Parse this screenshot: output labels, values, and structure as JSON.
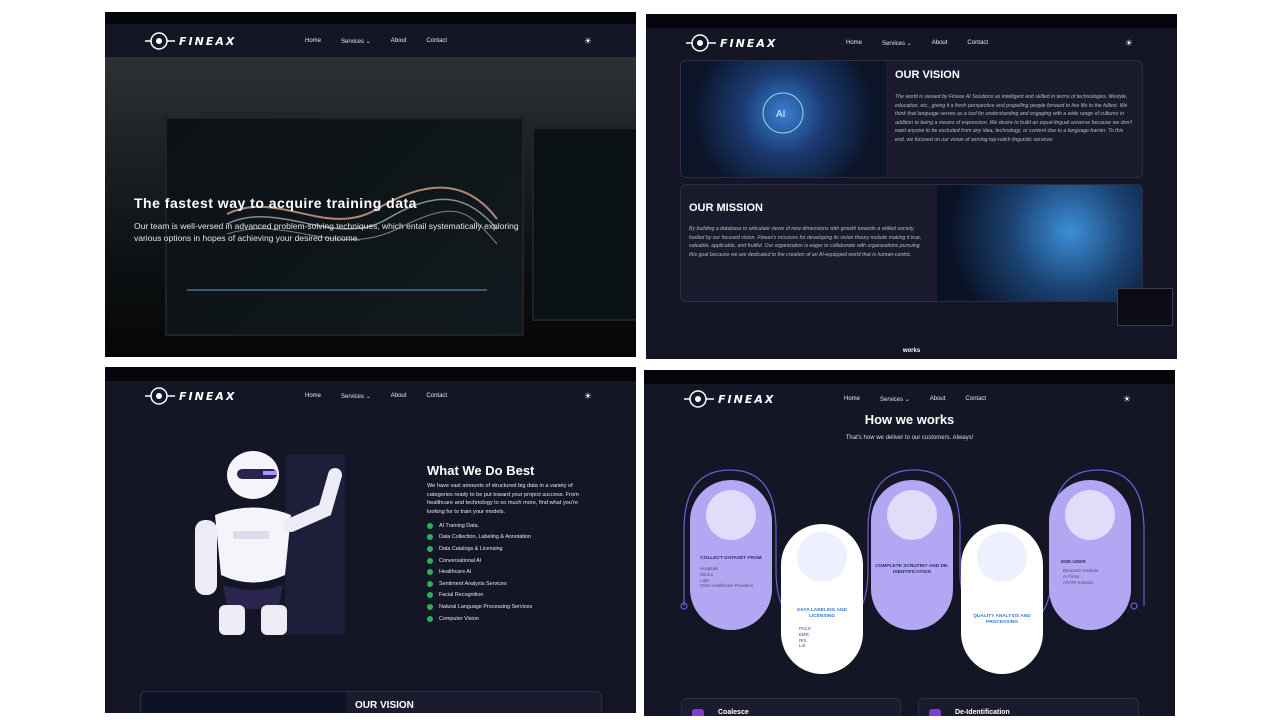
{
  "brand": {
    "name": "FINEAX"
  },
  "nav": {
    "home": "Home",
    "services": "Services",
    "about": "About",
    "contact": "Contact"
  },
  "hero": {
    "title": "The fastest way to acquire training data",
    "subtitle": "Our team is well-versed in advanced problem-solving techniques, which entail systematically exploring various options in hopes of achieving your desired outcome."
  },
  "vision": {
    "title": "OUR VISION",
    "text": "The world is viewed by Fineax AI Solutions as intelligent and skilled in terms of technologies, lifestyle, education, etc., giving it a fresh perspective and propelling people forward to live life to the fullest. We think that language serves as a tool for understanding and engaging with a wide range of cultures in addition to being a means of expression. We desire to build an equal-lingual universe because we don't want anyone to be excluded from any idea, technology, or content due to a language barrier. To this end, we focused on our vision of serving top-notch linguistic services"
  },
  "mission": {
    "title": "OUR MISSION",
    "text": "By building a database to articulate views of new dimensions with growth towards a skilled society, fuelled by our focused vision. Fineax's missions for developing its vision theory include making it true, valuable, applicable, and fruitful. Our organization is eager to collaborate with organizations pursuing this goal because we are dedicated to the creation of an AI-equipped world that is human-centric."
  },
  "panel2_footer": "works",
  "what_we_do": {
    "title": "What We Do Best",
    "description": "We have vast amounts of structured big data in a variety of categories ready to be put toward your project success. From healthcare and technology to so much more, find what you're looking for to train your models.",
    "items": [
      "AI Training Data.",
      "Data Collection, Labeling & Annotation",
      "Data Catalogs & Licensing",
      "Conversational AI",
      "Healthcare AI",
      "Sentiment Analysis Services",
      "Facial Recognition",
      "Natural Language Processing Services",
      "Computer Vision"
    ]
  },
  "panel3_footer": "OUR VISION",
  "how_we_works": {
    "title": "How we works",
    "subtitle": "That's how we deliver to our customers. Always!",
    "steps": [
      {
        "label": "COLLECT DATASET FROM",
        "items": [
          "Hospitals",
          "Clinics",
          "Labs",
          "Other Healthcare Providers"
        ]
      },
      {
        "label": "DATA LABELING AND LICENSING",
        "items": [
          "PACS",
          "EMR",
          "RIS",
          "LIS"
        ]
      },
      {
        "label": "COMPLETE SCRUTINY AND DE-IDENTIFICATION",
        "items": []
      },
      {
        "label": "QUALITY ANALYSIS AND PROCESSING",
        "items": []
      },
      {
        "label": "END USER",
        "items": [
          "Research Institute",
          "AI Firms",
          "AR/VR Solution"
        ]
      }
    ],
    "cards": [
      "Coalesce",
      "De-Identification"
    ]
  }
}
